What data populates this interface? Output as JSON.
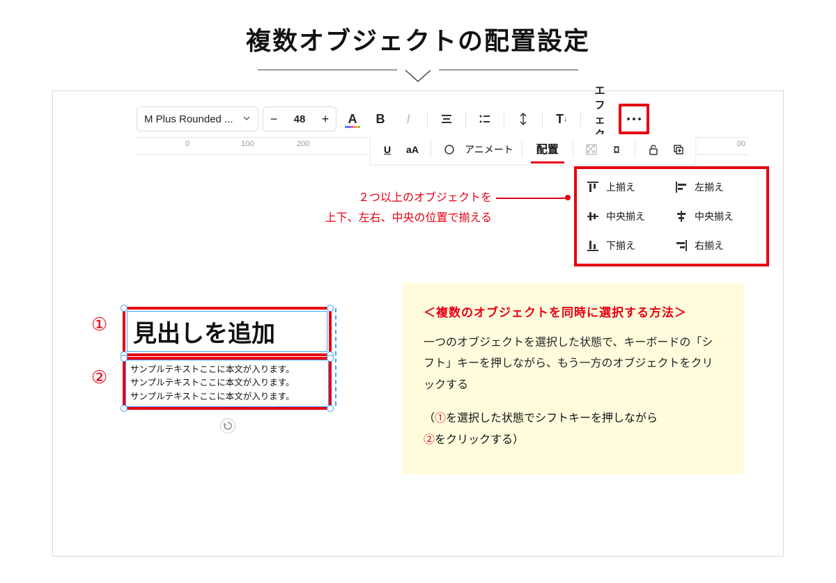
{
  "title": "複数オブジェクトの配置設定",
  "toolbar": {
    "font_name": "M Plus Rounded ...",
    "minus": "−",
    "size": "48",
    "plus": "+",
    "A": "A",
    "B": "B",
    "I": "I",
    "effect": "エフェクト"
  },
  "ruler_ticks": [
    "0",
    "100",
    "200",
    "00"
  ],
  "toolbar2": {
    "U": "U",
    "aA": "aA",
    "animate": "アニメート",
    "position": "配置"
  },
  "align": {
    "top": "上揃え",
    "middle": "中央揃え",
    "bottom": "下揃え",
    "left": "左揃え",
    "center": "中央揃え",
    "right": "右揃え"
  },
  "anno_l1": "２つ以上のオブジェクトを",
  "anno_l2": "上下、左右、中央の位置で揃える",
  "circ1": "①",
  "circ2": "②",
  "headline": "見出しを追加",
  "sample_line": "サンプルテキストここに本文が入ります。",
  "info": {
    "heading": "＜複数のオブジェクトを同時に選択する方法＞",
    "body": "一つのオブジェクトを選択した状態で、キーボードの「シフト」キーを押しながら、もう一方のオブジェクトをクリックする",
    "note_a": "（",
    "note_1": "①",
    "note_b": "を選択した状態でシフトキーを押しながら",
    "note_2": "②",
    "note_c": "をクリックする）"
  }
}
